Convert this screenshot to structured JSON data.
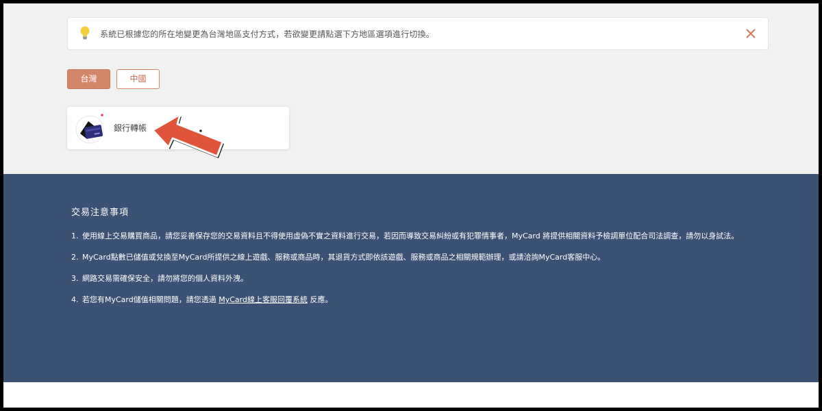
{
  "notice": {
    "icon": "lightbulb-icon",
    "text": "系統已根據您的所在地變更為台灣地區支付方式，若欲變更請點選下方地區選項進行切換。",
    "close_icon": "close-icon"
  },
  "regions": {
    "items": [
      {
        "label": "台灣",
        "selected": true
      },
      {
        "label": "中國",
        "selected": false
      }
    ]
  },
  "payment_methods": [
    {
      "label": "銀行轉帳",
      "icon": "bank-card-icon"
    }
  ],
  "annotation": {
    "icon": "pointing-arrow-icon"
  },
  "notes": {
    "title": "交易注意事項",
    "items": [
      {
        "num": "1.",
        "text": "使用線上交易購買商品，請您妥善保存您的交易資料且不得使用虛偽不實之資料進行交易，若因而導致交易糾紛或有犯罪情事者，MyCard 將提供相關資料予檢調單位配合司法調查，請勿以身試法。"
      },
      {
        "num": "2.",
        "text": "MyCard點數已儲值或兌換至MyCard所提供之線上遊戲、服務或商品時，其退貨方式即依該遊戲、服務或商品之相關規範辦理，或請洽詢MyCard客服中心。"
      },
      {
        "num": "3.",
        "text": "網路交易需確保安全，請勿將您的個人資料外洩。"
      },
      {
        "num": "4.",
        "text_before": "若您有MyCard儲值相關問題，請您透過",
        "link": "MyCard線上客服回覆系統",
        "text_after": "反應。"
      }
    ]
  },
  "colors": {
    "accent": "#d4866a",
    "footer_bg": "#3b5275",
    "top_bg": "#f1f1f1",
    "arrow": "#e0553a"
  }
}
